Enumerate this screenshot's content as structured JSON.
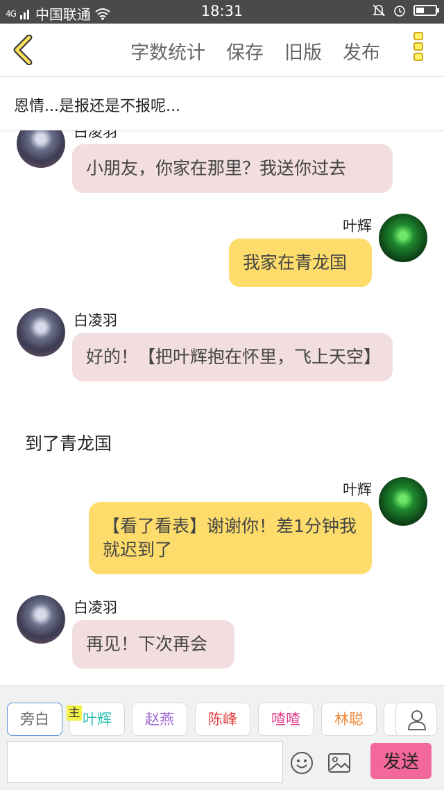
{
  "status_bar": {
    "signal": "4G",
    "carrier": "中国联通",
    "time": "18:31"
  },
  "header": {
    "menu": [
      "字数统计",
      "保存",
      "旧版",
      "发布"
    ]
  },
  "story": {
    "title": "恩情...是报还是不报呢..."
  },
  "messages": [
    {
      "type": "left",
      "name": "白凌羽",
      "text": "小朋友，你家在那里？我送你过去"
    },
    {
      "type": "right",
      "name": "叶辉",
      "text": "我家在青龙国"
    },
    {
      "type": "left",
      "name": "白凌羽",
      "text": "好的！【把叶辉抱在怀里，飞上天空】"
    },
    {
      "type": "narration",
      "text": "到了青龙国"
    },
    {
      "type": "right",
      "name": "叶辉",
      "text": "【看了看表】谢谢你！差1分钟我就迟到了"
    },
    {
      "type": "left",
      "name": "白凌羽",
      "text": "再见！下次再会"
    }
  ],
  "characters": [
    {
      "label": "旁白",
      "color": "#666666"
    },
    {
      "label": "叶辉",
      "color": "#2bbfb0"
    },
    {
      "label": "赵燕",
      "color": "#a06ad0"
    },
    {
      "label": "陈峰",
      "color": "#e04040"
    },
    {
      "label": "喳喳",
      "color": "#e0408a"
    },
    {
      "label": "林聪",
      "color": "#f08a40"
    }
  ],
  "main_tag": "主",
  "composer": {
    "input_value": "",
    "send_label": "发送"
  },
  "colors": {
    "accent_yellow": "#fddc6b",
    "bubble_pink": "#f2dede",
    "send_button": "#f3689a"
  }
}
